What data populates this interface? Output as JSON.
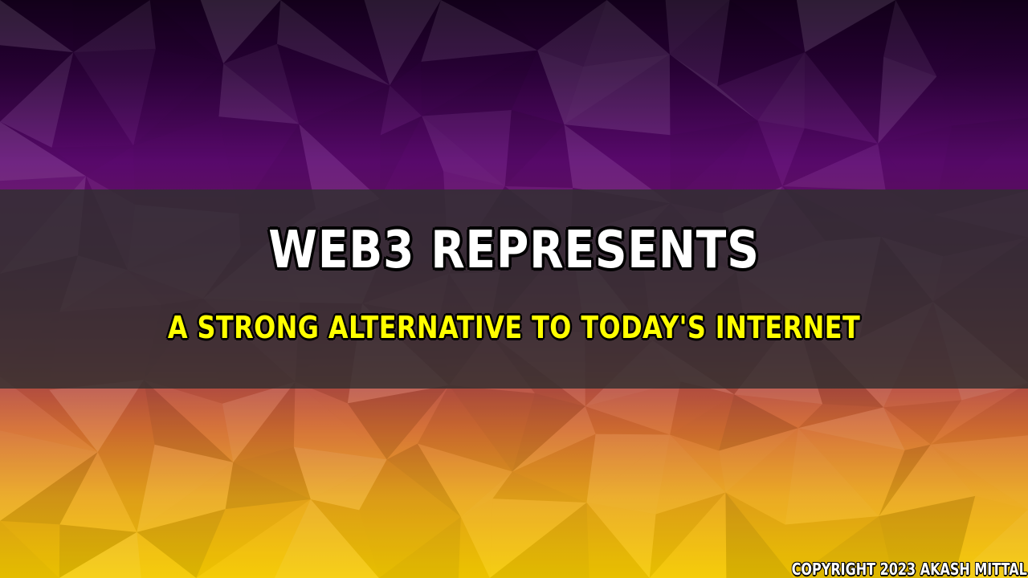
{
  "headline": "WEB3 REPRESENTS",
  "subheadline": "A STRONG ALTERNATIVE TO TODAY'S INTERNET",
  "copyright": "COPYRIGHT 2023 AKASH MITTAL",
  "colors": {
    "headline": "#ffffff",
    "subheadline": "#ffff00",
    "band": "#303030",
    "background_top": "#1a0022",
    "background_upper": "#5a0a6e",
    "background_middle": "#8a2f5a",
    "background_lower": "#d97a2a",
    "background_bottom": "#f2c400"
  }
}
